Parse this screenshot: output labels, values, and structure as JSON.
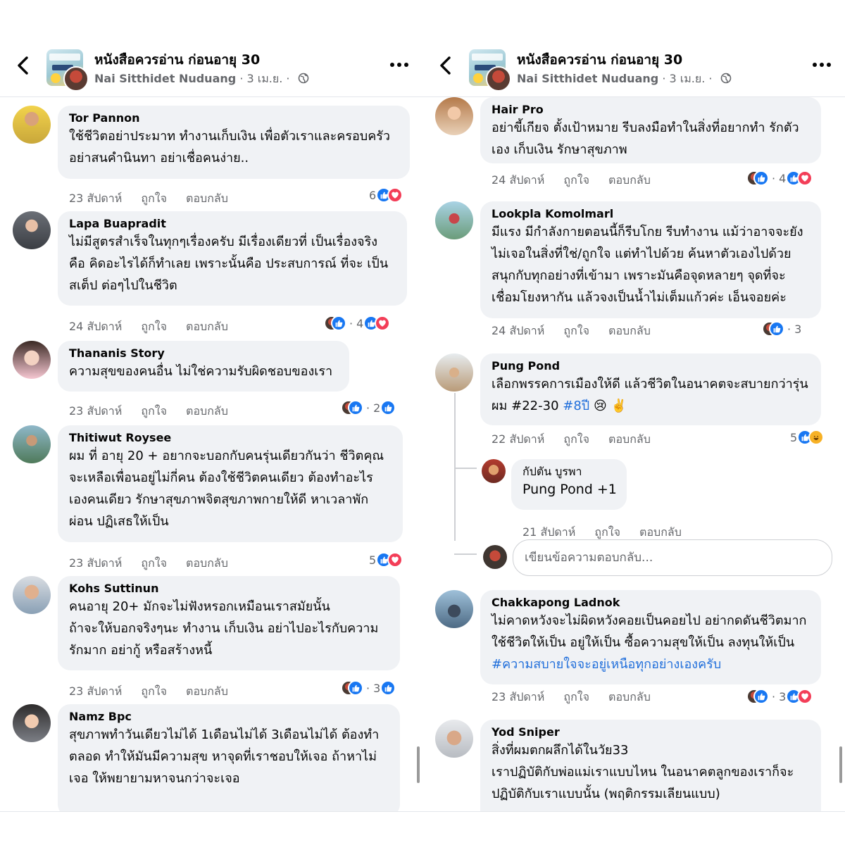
{
  "header": {
    "page_name": "หนังสือควรอ่าน ก่อนอายุ 30",
    "owner": "Nai Sitthidet Nuduang",
    "date": "3 เม.ย.",
    "separator": "·"
  },
  "actions": {
    "like": "ถูกใจ",
    "reply": "ตอบกลับ"
  },
  "left_comments": [
    {
      "name": "Tor Pannon",
      "lines": [
        "ใช้ชีวิตอย่าประมาท ทำงานเก็บเงิน เพื่อตัวเราและครอบครัว",
        "อย่าสนคำนินทา อย่าเชื่อคนง่าย.."
      ],
      "time": "23 สัปดาห์",
      "count": "6"
    },
    {
      "name": "Lapa Buapradit",
      "lines": [
        "ไม่มีสูตรสำเร็จในทุกๆเรื่องครับ มีเรื่องเดียวที่ เป็นเรื่องจริง",
        "คือ คิดอะไรได้ก็ทำเลย เพราะนั้นคือ ประสบการณ์ ที่จะ เป็น",
        "สเต็ป ต่อๆไปในชีวิต"
      ],
      "time": "24 สัปดาห์",
      "count": "4"
    },
    {
      "name": "Thananis Story",
      "lines": [
        "ความสุขของคนอื่น ไม่ใช่ความรับผิดชอบของเรา"
      ],
      "time": "23 สัปดาห์",
      "count": "2"
    },
    {
      "name": "Thitiwut Roysee",
      "lines": [
        "ผม ที่ อายุ 20 + อยากจะบอกกับคนรุ่นเดียวกันว่า ชีวิตคุณ",
        "จะเหลือเพื่อนอยู่ไม่กี่คน ต้องใช้ชีวิตคนเดียว ต้องทำอะไร",
        "เองคนเดียว รักษาสุขภาพจิตสุขภาพกายให้ดี หาเวลาพัก",
        "ผ่อน ปฏิเสธให้เป็น"
      ],
      "time": "23 สัปดาห์",
      "count": "5"
    },
    {
      "name": "Kohs Suttinun",
      "lines": [
        "คนอายุ 20+ มักจะไม่ฟังหรอกเหมือนเราสมัยนั้น",
        "ถ้าจะให้บอกจริงๆนะ ทำงาน เก็บเงิน อย่าไปอะไรกับความ",
        "รักมาก อย่ากู้ หรือสร้างหนี้"
      ],
      "time": "23 สัปดาห์",
      "count": "3"
    },
    {
      "name": "Namz Bpc",
      "lines": [
        "สุขภาพทำวันเดียวไม่ได้ 1เดือนไม่ได้ 3เดือนไม่ได้ ต้องทำ",
        "ตลอด ทำให้มันมีความสุข หาจุดที่เราชอบให้เจอ ถ้าหาไม่",
        "เจอ ให้พยายามหาจนกว่าจะเจอ"
      ]
    }
  ],
  "right_comments": [
    {
      "name": "Hair Pro",
      "lines": [
        "อย่าขี้เกียจ ตั้งเป้าหมาย รีบลงมือทำในสิ่งที่อยากทำ รักตัว",
        "เอง เก็บเงิน รักษาสุขภาพ"
      ],
      "time": "24 สัปดาห์",
      "count": "4"
    },
    {
      "name": "Lookpla Komolmarl",
      "lines": [
        "มีแรง มีกำลังกายตอนนี้ก็รีบโกย รีบทำงาน แม้ว่าอาจจะยัง",
        "ไม่เจอในสิ่งที่ใช่/ถูกใจ แต่ทำไปด้วย ค้นหาตัวเองไปด้วย",
        "สนุกกับทุกอย่างที่เข้ามา เพราะมันคือจุดหลายๆ จุดที่จะ",
        "เชื่อมโยงหากัน แล้วจงเป็นน้ำไม่เต็มแก้วค่ะ เอ็นจอยค่ะ"
      ],
      "time": "24 สัปดาห์",
      "count": "3"
    },
    {
      "name": "Pung Pond",
      "line1": "เลือกพรรคการเมืองให้ดี แล้วชีวิตในอนาคตจะสบายกว่ารุ่น",
      "line2_prefix": "ผม #22-30 ",
      "hashtag": "#8ปี",
      "emoji": "😢 ✌️",
      "time": "22 สัปดาห์",
      "count": "5"
    },
    {
      "name": "กัปตัน บูรพา",
      "text": "Pung Pond +1",
      "time": "21 สัปดาห์"
    },
    {
      "name": "Chakkapong Ladnok",
      "lines": [
        "ไม่คาดหวังจะไม่ผิดหวังคอยเป็นคอยไป อย่ากดดันชีวิตมาก",
        "ใช้ชีวิตให้เป็น อยู่ให้เป็น ซื้อความสุขให้เป็น ลงทุนให้เป็น"
      ],
      "hashtag": "#ความสบายใจจะอยู่เหนือทุกอย่างเองครับ",
      "time": "23 สัปดาห์",
      "count": "3"
    },
    {
      "name": "Yod Sniper",
      "lines": [
        "สิ่งที่ผมตกผลึกได้ในวัย33",
        "เราปฏิบัติกับพ่อแม่เราแบบไหน ในอนาคตลูกของเราก็จะ",
        "ปฏิบัติกับเราแบบนั้น (พฤติกรรมเลียนแบบ)"
      ]
    }
  ],
  "reply_input": {
    "placeholder": "เขียนข้อความตอบกลับ..."
  },
  "colors": {
    "like": "#1877f2",
    "love": "#f33e58",
    "haha": "#f7b125",
    "bubble": "#f0f2f5",
    "link": "#216fdb",
    "meta": "#65676b"
  }
}
